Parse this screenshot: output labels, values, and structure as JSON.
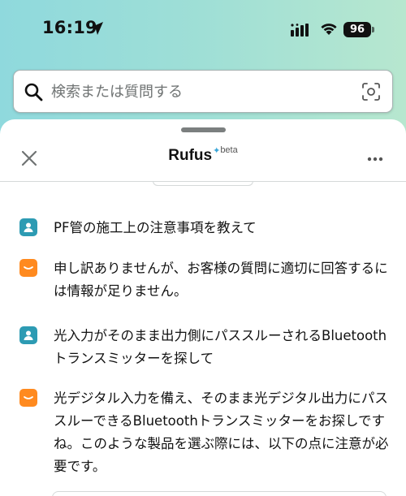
{
  "status_bar": {
    "time": "16:19",
    "battery": "96",
    "location_icon": "location-arrow-icon",
    "signal_icon": "cellular-signal-icon",
    "wifi_icon": "wifi-icon"
  },
  "search": {
    "placeholder": "検索または質問する",
    "value": "",
    "left_icon": "search-icon",
    "right_icon": "camera-scan-icon"
  },
  "sheet": {
    "title": "Rufus",
    "badge": "beta",
    "close_icon": "close-icon",
    "more_icon": "more-options-icon"
  },
  "messages": [
    {
      "role": "user",
      "text": "PF管の施工上の注意事項を教えて"
    },
    {
      "role": "assistant",
      "text": "申し訳ありませんが、お客様の質問に適切に回答するには情報が足りません。"
    },
    {
      "role": "user",
      "text": "光入力がそのまま出力側にパススルーされるBluetoothトランスミッターを探して"
    },
    {
      "role": "assistant",
      "text": "光デジタル入力を備え、そのまま光デジタル出力にパススルーできるBluetoothトランスミッターをお探しですね。このような製品を選ぶ際には、以下の点に注意が必要です。"
    }
  ],
  "colors": {
    "user_avatar": "#2d9bb3",
    "assistant_avatar": "#ff8a1f",
    "header_gradient_start": "#8fd9dd",
    "header_gradient_end": "#b7e7cf"
  }
}
